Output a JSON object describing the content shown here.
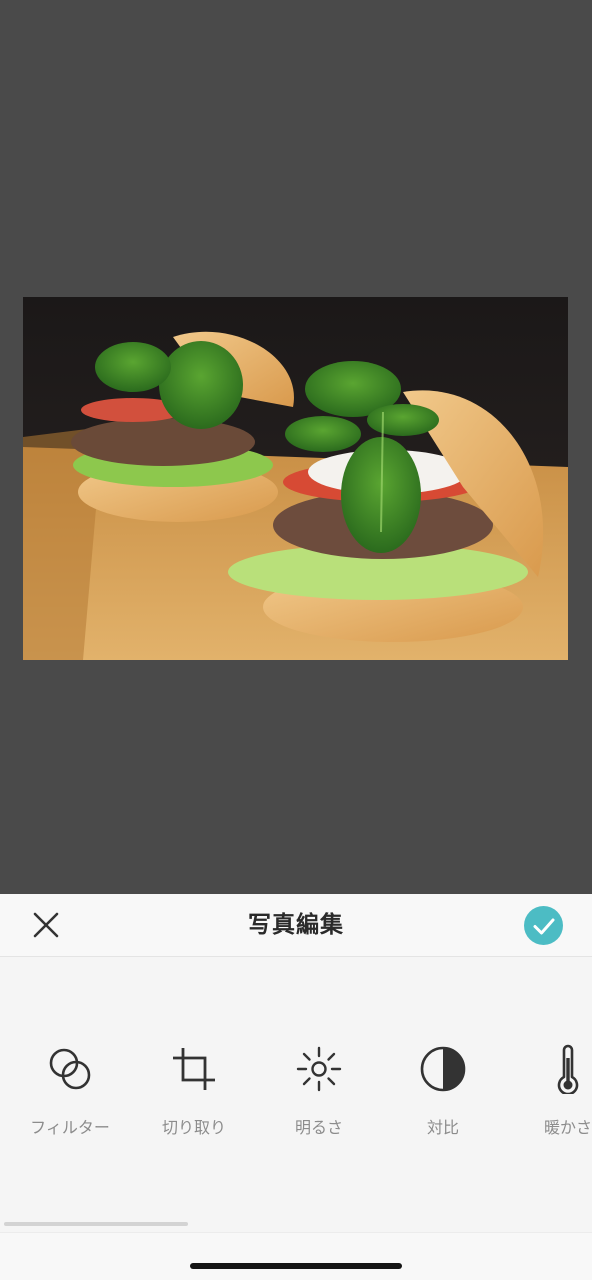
{
  "header": {
    "title": "写真編集"
  },
  "tools": [
    {
      "label": "フィルター",
      "icon": "filter-icon"
    },
    {
      "label": "切り取り",
      "icon": "crop-icon"
    },
    {
      "label": "明るさ",
      "icon": "brightness-icon"
    },
    {
      "label": "対比",
      "icon": "contrast-icon"
    },
    {
      "label": "暖かさ",
      "icon": "thermometer-icon"
    }
  ],
  "colors": {
    "accent": "#4cbcc4",
    "preview_background": "#4a4a4a",
    "panel_background": "#f5f5f5",
    "tool_label": "#8c8c8c"
  }
}
